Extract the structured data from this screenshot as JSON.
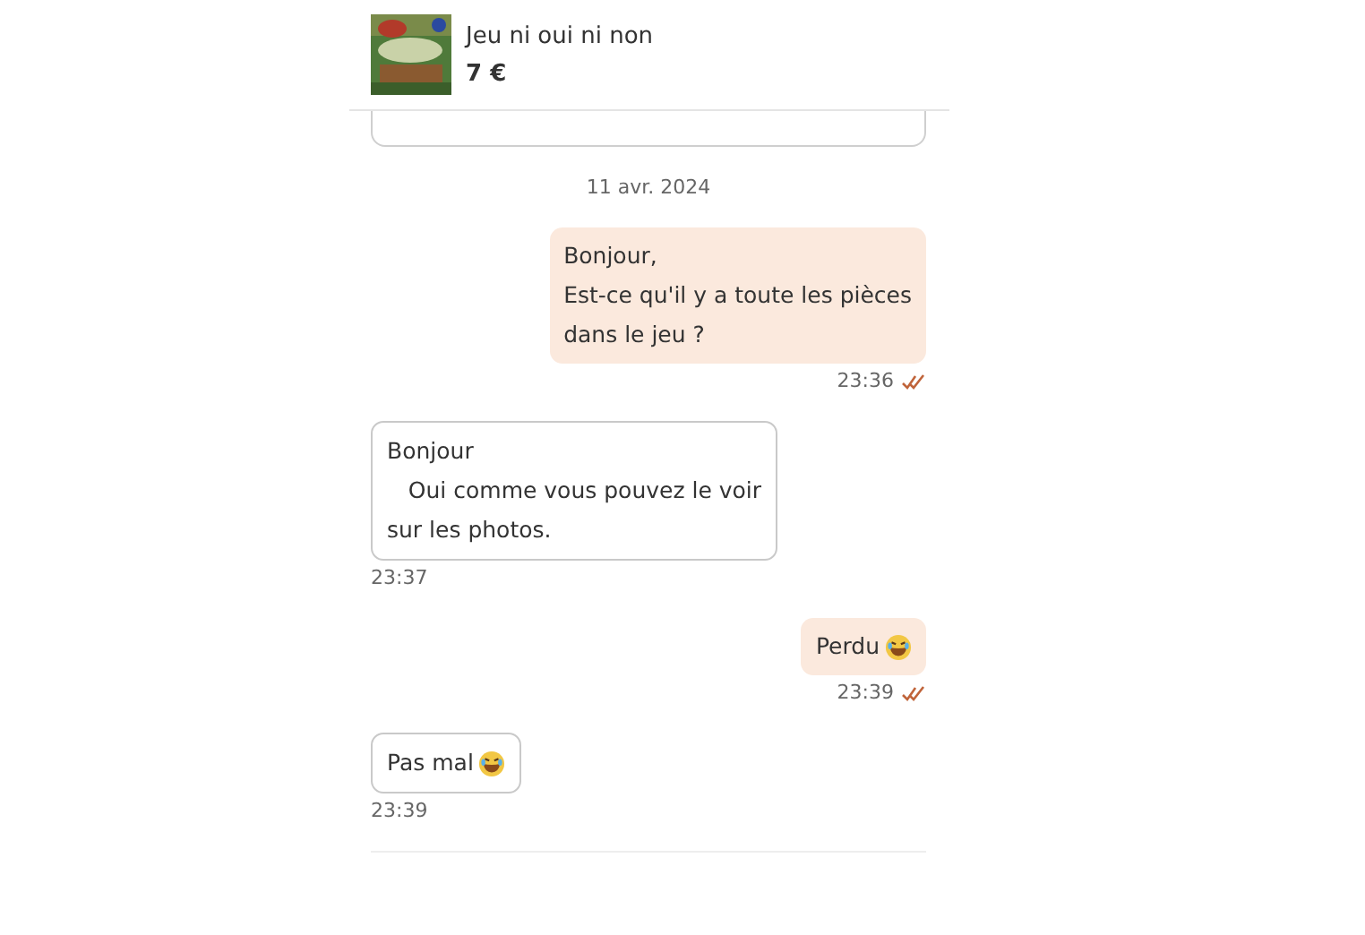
{
  "header": {
    "title": "Jeu ni oui ni non",
    "price": "7 €"
  },
  "date": "11 avr. 2024",
  "messages": [
    {
      "kind": "sent",
      "lines": [
        "Bonjour,",
        "Est-ce qu'il y a toute les pièces",
        "dans le jeu ?"
      ],
      "time": "23:36",
      "read": true
    },
    {
      "kind": "received",
      "lines": [
        "Bonjour",
        "   Oui comme vous pouvez le voir",
        "sur les photos."
      ],
      "time": "23:37"
    },
    {
      "kind": "sent",
      "lines": [
        "Perdu"
      ],
      "laughing_emoji": true,
      "time": "23:39",
      "read": true
    },
    {
      "kind": "received",
      "lines": [
        "Pas mal"
      ],
      "laughing_emoji": true,
      "time": "23:39"
    }
  ]
}
